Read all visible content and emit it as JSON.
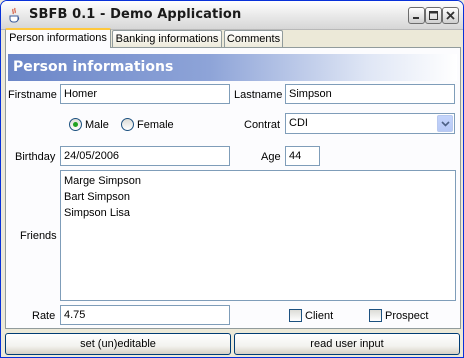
{
  "window": {
    "title": "SBFB 0.1 - Demo Application",
    "app_icon": "java-cup-icon",
    "controls": [
      "minimize-icon",
      "maximize-icon",
      "close-icon"
    ]
  },
  "tabs": [
    {
      "label": "Person informations",
      "active": true
    },
    {
      "label": "Banking informations",
      "active": false
    },
    {
      "label": "Comments",
      "active": false
    }
  ],
  "section": {
    "title": "Person informations"
  },
  "form": {
    "firstname_label": "Firstname",
    "firstname_value": "Homer",
    "lastname_label": "Lastname",
    "lastname_value": "Simpson",
    "gender": {
      "options": [
        "Male",
        "Female"
      ],
      "selected": "Male"
    },
    "contrat_label": "Contrat",
    "contrat_value": "CDI",
    "birthday_label": "Birthday",
    "birthday_value": "24/05/2006",
    "age_label": "Age",
    "age_value": "44",
    "friends_label": "Friends",
    "friends": [
      "Marge Simpson",
      "Bart Simpson",
      "Simpson Lisa"
    ],
    "rate_label": "Rate",
    "rate_value": "4.75",
    "client_label": "Client",
    "client_checked": false,
    "prospect_label": "Prospect",
    "prospect_checked": false
  },
  "buttons": {
    "editable": "set (un)editable",
    "read_input": "read user input"
  },
  "colors": {
    "header_gradient_start": "#6b86c8",
    "field_border": "#7f9db9",
    "radio_dot": "#21a121",
    "active_tab_accent": "#ffc83c"
  }
}
